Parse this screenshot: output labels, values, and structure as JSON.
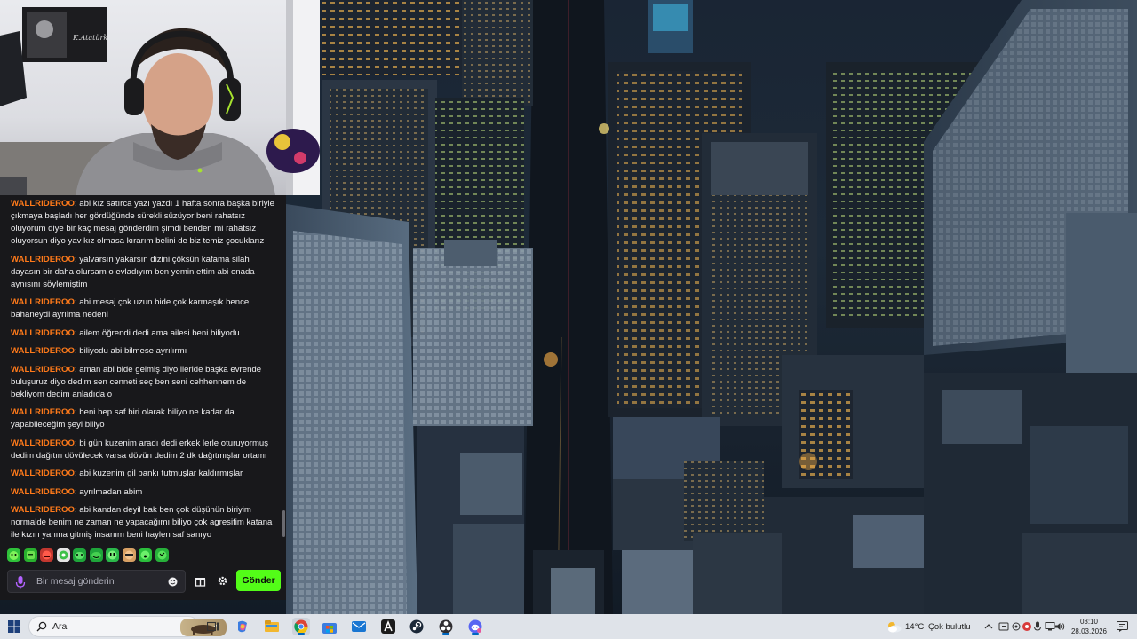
{
  "chat": {
    "messages": [
      {
        "user": "WALLRIDEROO",
        "text": "abi kız satırca yazı yazdı 1 hafta sonra başka biriyle çıkmaya başladı her gördüğünde sürekli süzüyor beni rahatsız oluyorum diye bir kaç mesaj gönderdim şimdi benden mi rahatsız oluyorsun diyo yav kız olmasa kırarım belini de biz temiz çocuklarız"
      },
      {
        "user": "WALLRIDEROO",
        "text": "yalvarsın yakarsın dizini çöksün kafama silah dayasın bir daha olursam o evladıyım ben yemin ettim abi onada aynısını söylemiştim"
      },
      {
        "user": "WALLRIDEROO",
        "text": "abi mesaj çok uzun bide çok karmaşık bence bahaneydi ayrılma nedeni"
      },
      {
        "user": "WALLRIDEROO",
        "text": "ailem öğrendi dedi ama ailesi beni biliyodu"
      },
      {
        "user": "WALLRIDEROO",
        "text": "biliyodu abi bilmese ayrılırmı"
      },
      {
        "user": "WALLRIDEROO",
        "text": "aman abi bide gelmiş diyo ileride başka evrende buluşuruz diyo dedim sen cenneti seç ben seni cehhennem de bekliyom dedim anladıda o"
      },
      {
        "user": "WALLRIDEROO",
        "text": "beni hep saf biri olarak biliyo ne kadar da yapabileceğim şeyi biliyo"
      },
      {
        "user": "WALLRIDEROO",
        "text": "bi gün kuzenim aradı dedi erkek lerle oturuyormuş dedim dağıtın dövülecek varsa dövün dedim 2 dk dağıtmışlar ortamı"
      },
      {
        "user": "WALLRIDEROO",
        "text": "abi kuzenim gil bankı tutmuşlar kaldırmışlar"
      },
      {
        "user": "WALLRIDEROO",
        "text": "ayrılmadan abim"
      },
      {
        "user": "WALLRIDEROO",
        "text": "abi kandan deyil bak ben çok düşünün biriyim normalde benim ne zaman ne yapacağımı biliyo çok agresifim katana ile kızın yanına gitmiş insanım beni haylen saf sanıyo"
      }
    ],
    "input_placeholder": "Bir mesaj gönderin",
    "send_label": "Gönder",
    "emotes": [
      "emote-1",
      "emote-2",
      "emote-3",
      "emote-4",
      "emote-5",
      "emote-6",
      "emote-7",
      "emote-8",
      "emote-9",
      "emote-10"
    ],
    "accent_color": "#53fc18",
    "username_color": "#ff7a1a"
  },
  "taskbar": {
    "search_placeholder": "Ara",
    "pinned": [
      "task-view-icon",
      "copilot-icon",
      "file-explorer-icon",
      "chrome-icon",
      "store-icon",
      "mail-icon",
      "app-a-icon",
      "steam-icon",
      "obs-icon",
      "discord-icon"
    ],
    "weather_temp": "14°C",
    "weather_desc": "Çok bulutlu",
    "time": "03:10",
    "date": "28.03.2026"
  }
}
